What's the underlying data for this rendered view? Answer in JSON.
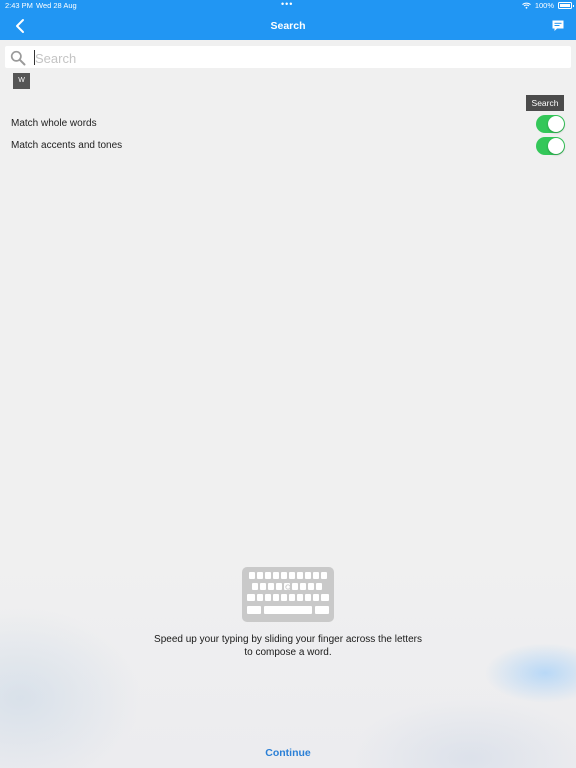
{
  "status_bar": {
    "time": "2:43 PM",
    "date": "Wed 28 Aug",
    "dots": "•••",
    "battery": "100%",
    "icons": [
      "wifi-icon",
      "battery-icon"
    ]
  },
  "nav": {
    "title": "Search",
    "back_icon": "chevron-left-icon",
    "chat_icon": "chat-icon"
  },
  "search": {
    "placeholder": "Search",
    "value": "",
    "keyboard_toggle_label": "W",
    "button_label": "Search"
  },
  "options": [
    {
      "label": "Match whole words",
      "enabled": true
    },
    {
      "label": "Match accents and tones",
      "enabled": true
    }
  ],
  "onboarding": {
    "message": "Speed up your typing by sliding your finger across the letters to compose a word.",
    "continue_label": "Continue"
  },
  "colors": {
    "accent": "#2196f3",
    "toggle_on": "#34c759",
    "link": "#2a7fd6",
    "background": "#f0f0f0"
  }
}
